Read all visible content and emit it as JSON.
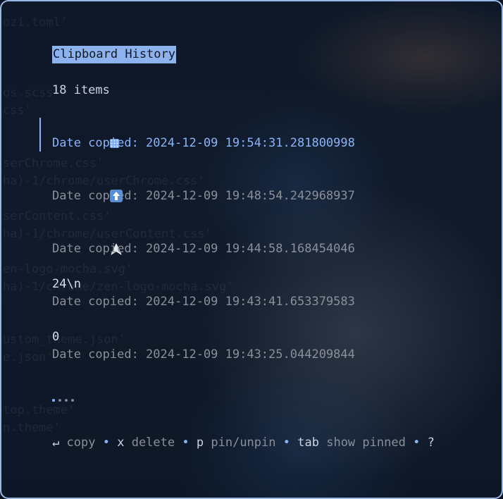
{
  "title": "Clipboard History",
  "count": "18 items",
  "items": [
    {
      "value": "",
      "icon": "grid-emoji-icon",
      "date": "Date copied: 2024-12-09 19:54:31.281800998",
      "selected": true
    },
    {
      "value": "",
      "icon": "up-arrow-emoji-icon",
      "date": "Date copied: 2024-12-09 19:48:54.242968937"
    },
    {
      "value": "",
      "icon": "cursor-arrow-icon",
      "date": "Date copied: 2024-12-09 19:44:58.168454046"
    },
    {
      "value": "24\\n",
      "date": "Date copied: 2024-12-09 19:43:41.653379583"
    },
    {
      "value": "0",
      "date": "Date copied: 2024-12-09 19:43:25.044209844"
    }
  ],
  "pager": {
    "pages": 4,
    "active_page": 1
  },
  "help": [
    {
      "key": "↵",
      "desc": "copy"
    },
    {
      "key": "x",
      "desc": "delete"
    },
    {
      "key": "p",
      "desc": "pin/unpin"
    },
    {
      "key": "tab",
      "desc": "show pinned"
    },
    {
      "key": "?",
      "desc": ""
    }
  ],
  "help_separator": "•",
  "background_code": [
    "ozi.toml'",
    "os.scss'",
    "css'",
    "serChrome.css'",
    "ha)-1/chrome/userChrome.css'",
    "serContent.css'",
    "ha)-1/chrome/userContent.css'",
    "en-logo-mocha.svg'",
    "ha)-1/chrome/zen-logo-mocha.svg'",
    "ustom_theme.json'",
    "e.json'",
    "top.theme'",
    "n.theme'"
  ],
  "colors": {
    "accent": "#8ab4f8",
    "border": "#9bb7e4",
    "dim_text": "#8a8f99",
    "text": "#d8dde8"
  }
}
